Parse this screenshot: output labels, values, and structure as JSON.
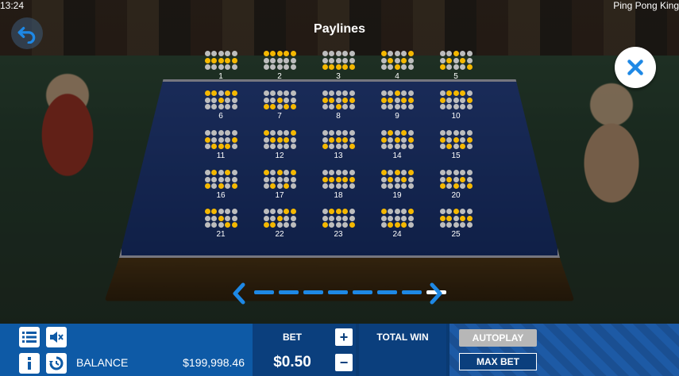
{
  "status": {
    "time": "13:24",
    "game_title": "Ping Pong King"
  },
  "panel": {
    "title": "Paylines"
  },
  "paylines": [
    {
      "num": "1",
      "rows": [
        [
          0,
          0,
          0,
          0,
          0
        ],
        [
          1,
          1,
          1,
          1,
          1
        ],
        [
          0,
          0,
          0,
          0,
          0
        ]
      ]
    },
    {
      "num": "2",
      "rows": [
        [
          1,
          1,
          1,
          1,
          1
        ],
        [
          0,
          0,
          0,
          0,
          0
        ],
        [
          0,
          0,
          0,
          0,
          0
        ]
      ]
    },
    {
      "num": "3",
      "rows": [
        [
          0,
          0,
          0,
          0,
          0
        ],
        [
          0,
          0,
          0,
          0,
          0
        ],
        [
          1,
          1,
          1,
          1,
          1
        ]
      ]
    },
    {
      "num": "4",
      "rows": [
        [
          1,
          0,
          0,
          0,
          1
        ],
        [
          0,
          1,
          0,
          1,
          0
        ],
        [
          0,
          0,
          1,
          0,
          0
        ]
      ]
    },
    {
      "num": "5",
      "rows": [
        [
          0,
          0,
          1,
          0,
          0
        ],
        [
          0,
          1,
          0,
          1,
          0
        ],
        [
          1,
          0,
          0,
          0,
          1
        ]
      ]
    },
    {
      "num": "6",
      "rows": [
        [
          1,
          1,
          0,
          1,
          1
        ],
        [
          0,
          0,
          1,
          0,
          0
        ],
        [
          0,
          0,
          0,
          0,
          0
        ]
      ]
    },
    {
      "num": "7",
      "rows": [
        [
          0,
          0,
          0,
          0,
          0
        ],
        [
          0,
          0,
          1,
          0,
          0
        ],
        [
          1,
          1,
          0,
          1,
          1
        ]
      ]
    },
    {
      "num": "8",
      "rows": [
        [
          0,
          0,
          0,
          0,
          0
        ],
        [
          1,
          1,
          0,
          1,
          1
        ],
        [
          0,
          0,
          1,
          0,
          0
        ]
      ]
    },
    {
      "num": "9",
      "rows": [
        [
          0,
          0,
          1,
          0,
          0
        ],
        [
          1,
          1,
          0,
          1,
          1
        ],
        [
          0,
          0,
          0,
          0,
          0
        ]
      ]
    },
    {
      "num": "10",
      "rows": [
        [
          0,
          1,
          1,
          1,
          0
        ],
        [
          1,
          0,
          0,
          0,
          1
        ],
        [
          0,
          0,
          0,
          0,
          0
        ]
      ]
    },
    {
      "num": "11",
      "rows": [
        [
          0,
          0,
          0,
          0,
          0
        ],
        [
          1,
          0,
          0,
          0,
          1
        ],
        [
          0,
          1,
          1,
          1,
          0
        ]
      ]
    },
    {
      "num": "12",
      "rows": [
        [
          1,
          0,
          0,
          0,
          1
        ],
        [
          0,
          1,
          1,
          1,
          0
        ],
        [
          0,
          0,
          0,
          0,
          0
        ]
      ]
    },
    {
      "num": "13",
      "rows": [
        [
          0,
          0,
          0,
          0,
          0
        ],
        [
          0,
          1,
          1,
          1,
          0
        ],
        [
          1,
          0,
          0,
          0,
          1
        ]
      ]
    },
    {
      "num": "14",
      "rows": [
        [
          0,
          1,
          0,
          1,
          0
        ],
        [
          1,
          0,
          1,
          0,
          1
        ],
        [
          0,
          0,
          0,
          0,
          0
        ]
      ]
    },
    {
      "num": "15",
      "rows": [
        [
          0,
          0,
          0,
          0,
          0
        ],
        [
          1,
          0,
          1,
          0,
          1
        ],
        [
          0,
          1,
          0,
          1,
          0
        ]
      ]
    },
    {
      "num": "16",
      "rows": [
        [
          0,
          1,
          0,
          1,
          0
        ],
        [
          0,
          0,
          0,
          0,
          0
        ],
        [
          1,
          0,
          1,
          0,
          1
        ]
      ]
    },
    {
      "num": "17",
      "rows": [
        [
          1,
          0,
          1,
          0,
          1
        ],
        [
          0,
          0,
          0,
          0,
          0
        ],
        [
          0,
          1,
          0,
          1,
          0
        ]
      ]
    },
    {
      "num": "18",
      "rows": [
        [
          0,
          0,
          0,
          0,
          0
        ],
        [
          1,
          1,
          1,
          1,
          1
        ],
        [
          0,
          0,
          0,
          0,
          0
        ]
      ]
    },
    {
      "num": "19",
      "rows": [
        [
          1,
          0,
          1,
          0,
          1
        ],
        [
          0,
          1,
          0,
          1,
          0
        ],
        [
          0,
          0,
          0,
          0,
          0
        ]
      ]
    },
    {
      "num": "20",
      "rows": [
        [
          0,
          0,
          0,
          0,
          0
        ],
        [
          0,
          1,
          0,
          1,
          0
        ],
        [
          1,
          0,
          1,
          0,
          1
        ]
      ]
    },
    {
      "num": "21",
      "rows": [
        [
          1,
          1,
          0,
          0,
          0
        ],
        [
          0,
          0,
          1,
          0,
          0
        ],
        [
          0,
          0,
          0,
          1,
          1
        ]
      ]
    },
    {
      "num": "22",
      "rows": [
        [
          0,
          0,
          0,
          1,
          1
        ],
        [
          0,
          0,
          1,
          0,
          0
        ],
        [
          1,
          1,
          0,
          0,
          0
        ]
      ]
    },
    {
      "num": "23",
      "rows": [
        [
          0,
          1,
          1,
          1,
          0
        ],
        [
          0,
          0,
          0,
          0,
          0
        ],
        [
          1,
          0,
          0,
          0,
          1
        ]
      ]
    },
    {
      "num": "24",
      "rows": [
        [
          1,
          0,
          0,
          0,
          1
        ],
        [
          0,
          0,
          0,
          0,
          0
        ],
        [
          0,
          1,
          1,
          1,
          0
        ]
      ]
    },
    {
      "num": "25",
      "rows": [
        [
          0,
          0,
          1,
          0,
          0
        ],
        [
          1,
          1,
          0,
          1,
          1
        ],
        [
          0,
          0,
          0,
          0,
          0
        ]
      ]
    }
  ],
  "pager": {
    "pages": 8,
    "active_page": 8
  },
  "bottom": {
    "balance_label": "BALANCE",
    "balance_value": "$199,998.46",
    "bet_label": "BET",
    "bet_value": "$0.50",
    "plus": "+",
    "minus": "−",
    "total_win_label": "TOTAL WIN",
    "autoplay_label": "AUTOPLAY",
    "maxbet_label": "MAX BET"
  },
  "colors": {
    "active_dot": "#f5b800",
    "inactive_dot": "#bdbdbd",
    "accent_blue": "#1e88e5"
  }
}
